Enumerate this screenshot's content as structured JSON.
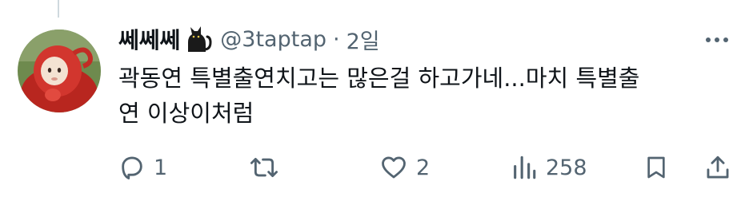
{
  "tweet": {
    "display_name": "쎄쎄쎄",
    "name_emoji": "black-cat-emoji",
    "handle": "@3taptap",
    "separator": "·",
    "time": "2일",
    "body_line1": "곽동연 특별출연치고는 많은걸 하고가네...마치 특별출",
    "body_line2": "연 이상이처럼",
    "avatar": "teletubby-po-avatar"
  },
  "actions": {
    "reply": {
      "icon": "reply-icon",
      "count": "1"
    },
    "retweet": {
      "icon": "retweet-icon",
      "count": ""
    },
    "like": {
      "icon": "heart-icon",
      "count": "2"
    },
    "views": {
      "icon": "views-icon",
      "count": "258"
    },
    "bookmark": {
      "icon": "bookmark-icon"
    },
    "share": {
      "icon": "share-icon"
    }
  },
  "colors": {
    "text": "#0f1419",
    "secondary": "#536471",
    "avatar_red": "#d2362e"
  }
}
